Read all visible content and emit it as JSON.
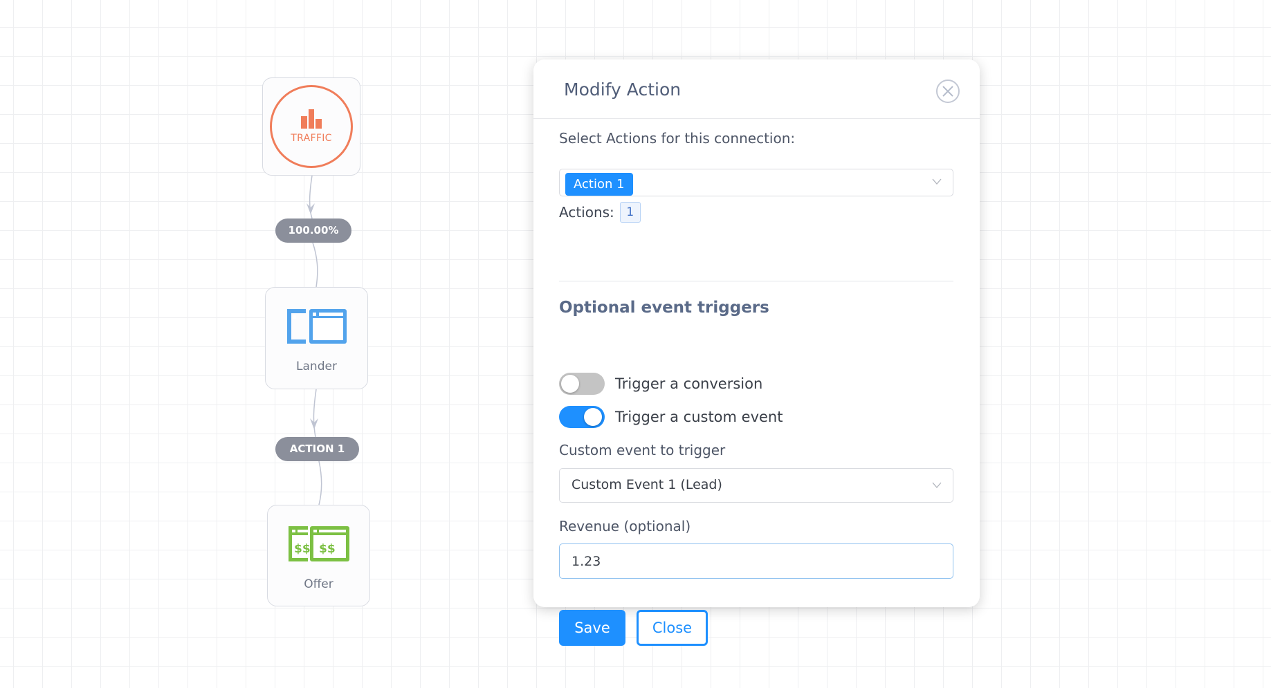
{
  "canvas": {
    "nodes": {
      "traffic": {
        "label": "TRAFFIC",
        "icon": "bar-chart-icon",
        "color": "#f07d5a"
      },
      "lander": {
        "label": "Lander",
        "icon": "browser-windows-icon",
        "color": "#52a3ec"
      },
      "offer": {
        "label": "Offer",
        "icon": "dollar-windows-icon",
        "color": "#7cc043",
        "icon_text": "$$"
      }
    },
    "connections": [
      {
        "label": "100.00%"
      },
      {
        "label": "ACTION 1"
      }
    ]
  },
  "modal": {
    "title": "Modify Action",
    "close_icon": "close-circle-icon",
    "actions_select": {
      "label": "Select Actions for this connection:",
      "selected": [
        "Action 1"
      ]
    },
    "actions_count": {
      "label": "Actions:",
      "value": "1"
    },
    "triggers": {
      "title": "Optional event triggers",
      "items": [
        {
          "label": "Trigger a conversion",
          "enabled": false
        },
        {
          "label": "Trigger a custom event",
          "enabled": true
        }
      ]
    },
    "custom_event": {
      "label": "Custom event to trigger",
      "selected": "Custom Event 1 (Lead)"
    },
    "revenue": {
      "label": "Revenue (optional)",
      "value": "1.23"
    },
    "buttons": {
      "save": "Save",
      "close": "Close"
    },
    "accent_color": "#1e90ff"
  }
}
